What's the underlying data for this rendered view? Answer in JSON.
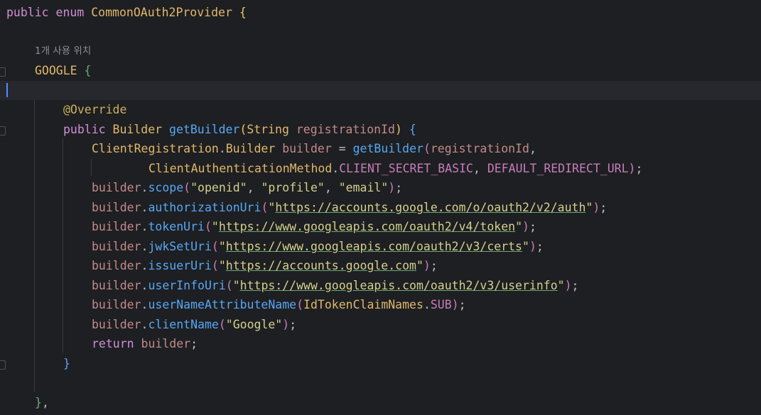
{
  "editor": {
    "language": "Java",
    "inlay_hint": "1개 사용 위치",
    "code": {
      "enum_decl": {
        "kw_public": "public",
        "kw_enum": "enum",
        "enum_name": "CommonOAuth2Provider",
        "open_brace": "{"
      },
      "google": {
        "name": "GOOGLE",
        "open_brace": "{"
      },
      "override": "@Override",
      "method_decl": {
        "kw_public": "public",
        "return_type": "Builder",
        "name": "getBuilder",
        "open_paren": "(",
        "param_type": "String",
        "param_name": "registrationId",
        "close_paren": ")",
        "open_brace": "{"
      },
      "builder_decl": {
        "type_a": "ClientRegistration",
        "dot": ".",
        "type_b": "Builder",
        "var": "builder",
        "assign": " = ",
        "call": "getBuilder",
        "open_paren": "(",
        "arg": "registrationId",
        "comma": ","
      },
      "builder_decl_cont": {
        "class": "ClientAuthenticationMethod",
        "dot": ".",
        "const": "CLIENT_SECRET_BASIC",
        "sep": ", ",
        "const2": "DEFAULT_REDIRECT_URL",
        "close": ")",
        "semi": ";"
      },
      "calls": [
        {
          "var": "builder",
          "method": "scope"
        },
        {
          "var": "builder",
          "method": "authorizationUri",
          "url": "https://accounts.google.com/o/oauth2/v2/auth"
        },
        {
          "var": "builder",
          "method": "tokenUri",
          "url": "https://www.googleapis.com/oauth2/v4/token"
        },
        {
          "var": "builder",
          "method": "jwkSetUri",
          "url": "https://www.googleapis.com/oauth2/v3/certs"
        },
        {
          "var": "builder",
          "method": "issuerUri",
          "url": "https://accounts.google.com"
        },
        {
          "var": "builder",
          "method": "userInfoUri",
          "url": "https://www.googleapis.com/oauth2/v3/userinfo"
        },
        {
          "var": "builder",
          "method": "userNameAttributeName",
          "arg_class": "IdTokenClaimNames",
          "arg_const": "SUB"
        },
        {
          "var": "builder",
          "method": "clientName",
          "str": "\"Google\""
        }
      ],
      "scope_args": [
        "\"openid\"",
        "\"profile\"",
        "\"email\""
      ],
      "return_stmt": {
        "kw": "return",
        "var": "builder",
        "semi": ";"
      },
      "method_close": "}",
      "google_close": "}",
      "google_close_comma": ","
    }
  }
}
